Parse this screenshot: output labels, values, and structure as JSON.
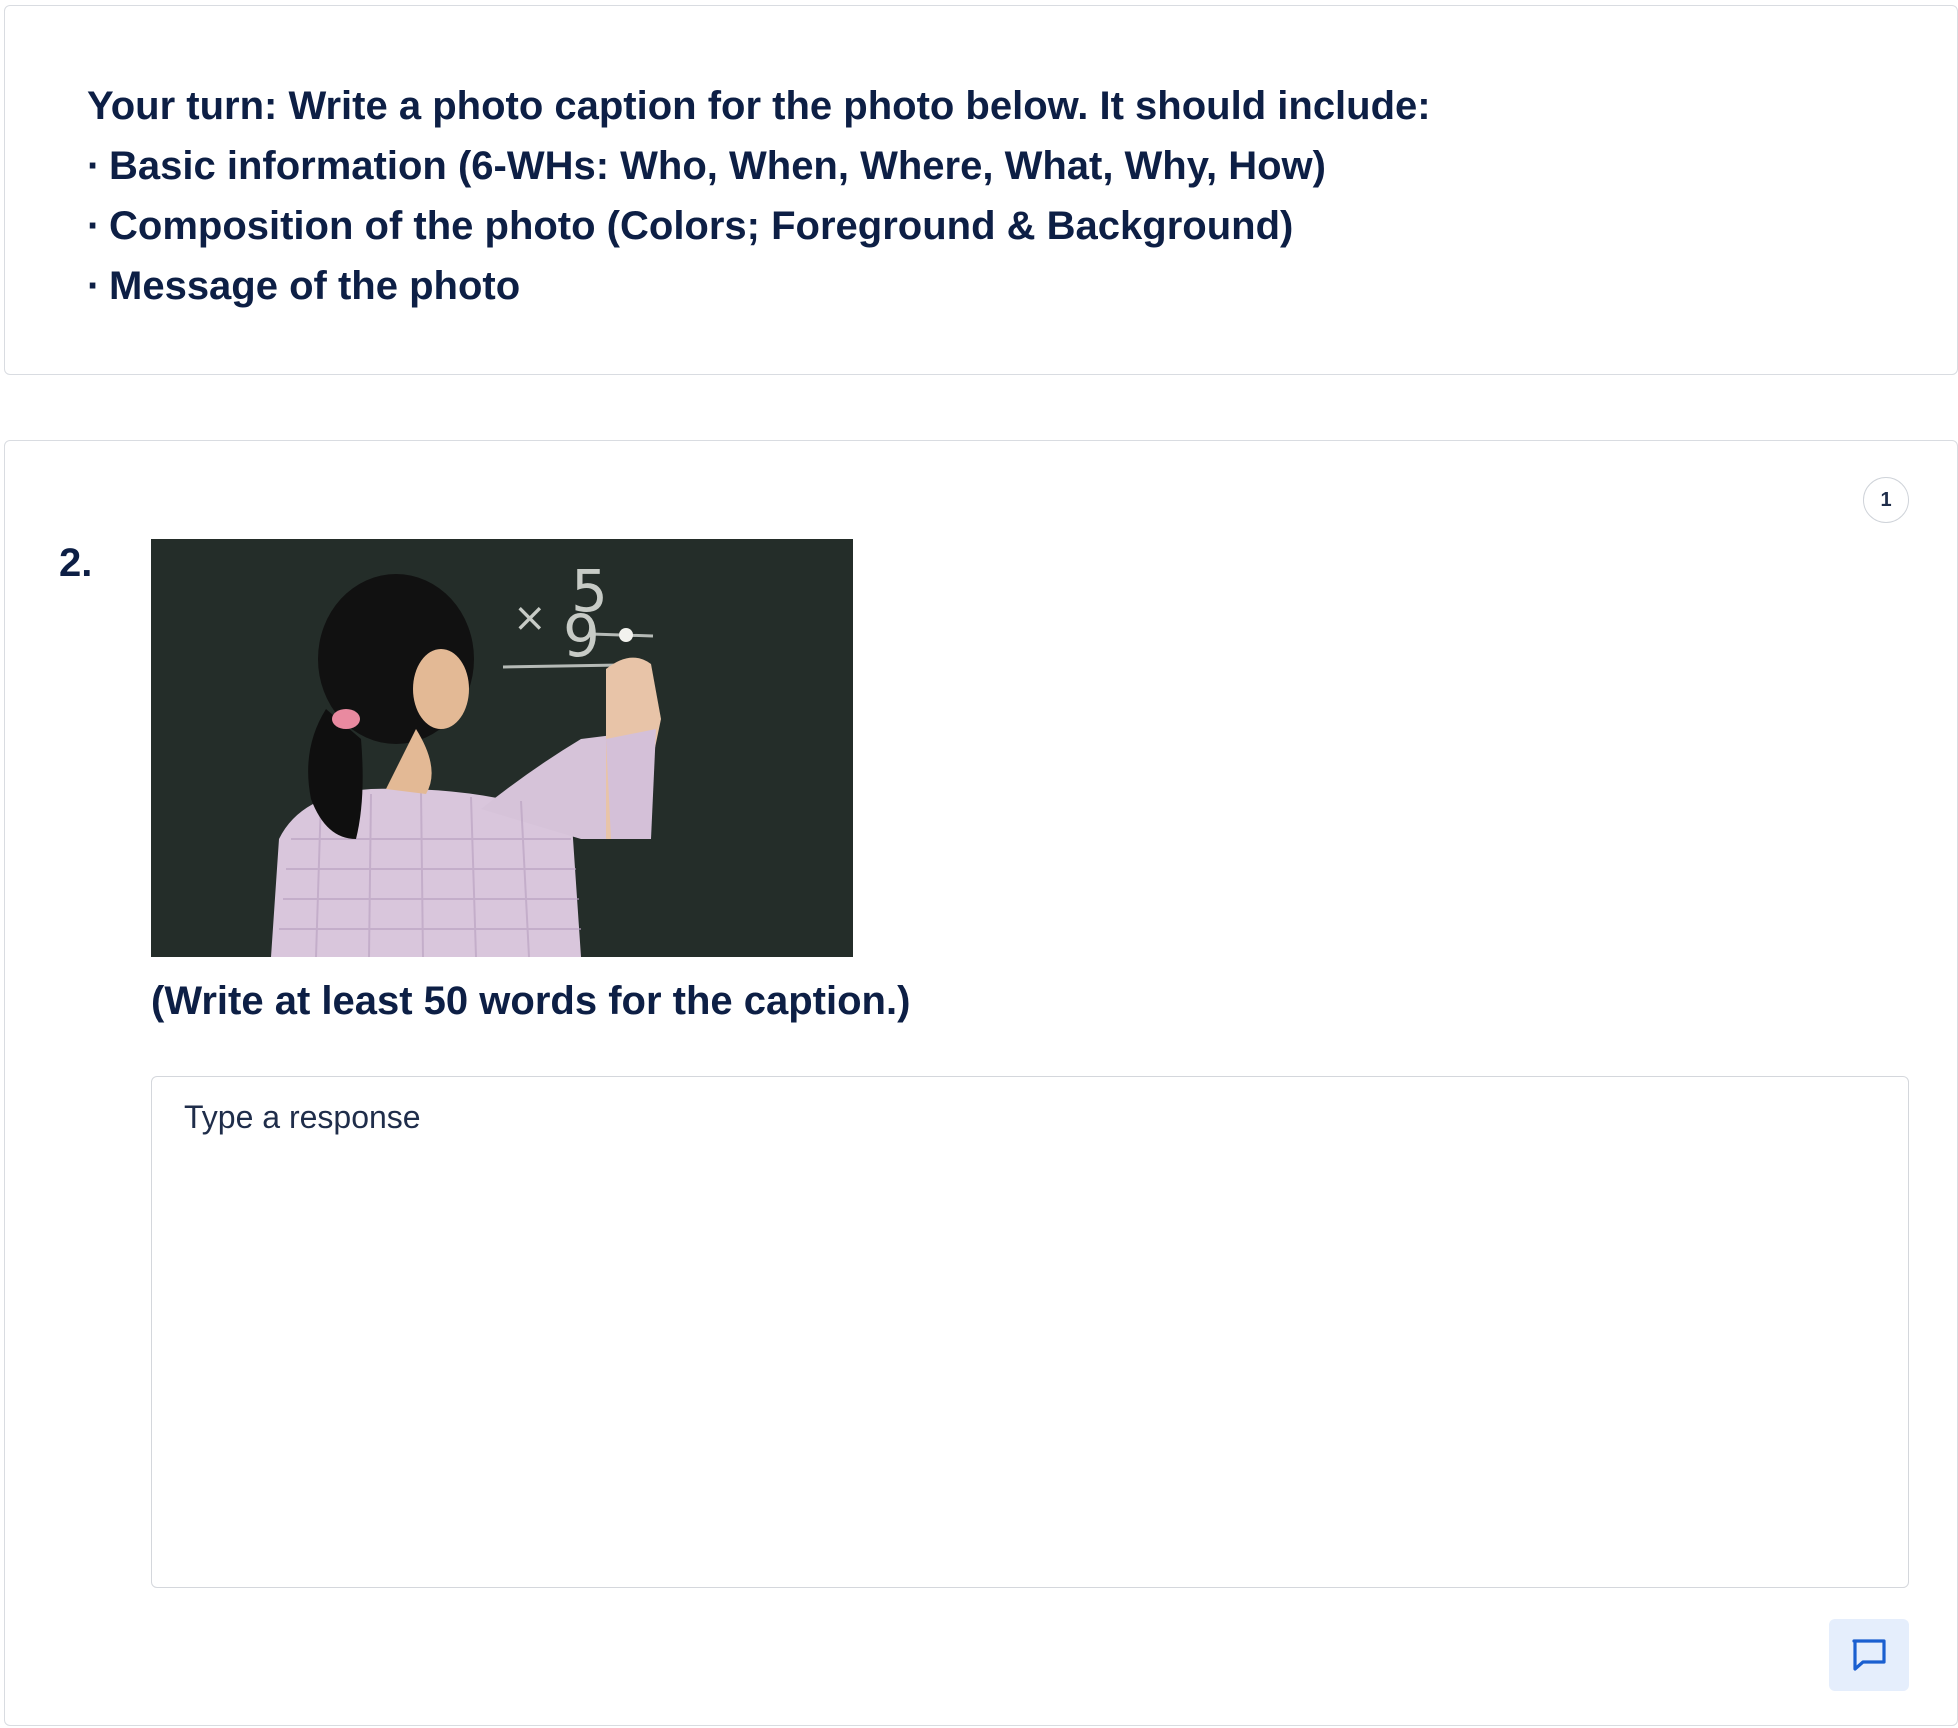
{
  "intro": {
    "lead_bold": "Your turn:",
    "lead_text": " Write a photo caption for the photo below. It should include:",
    "bullets": [
      "Basic information (6-WHs: Who, When, Where, What, Why, How)",
      "Composition of the photo (Colors; Foreground & Background)",
      "Message of the photo"
    ],
    "bullet_symbol": "·"
  },
  "question": {
    "number": "2.",
    "points": "1",
    "photo": {
      "chalk_digits": [
        "5",
        "×",
        "9"
      ]
    },
    "hint": "(Write at least 50 words for the caption.)",
    "response": {
      "placeholder": "Type a response"
    },
    "comment_icon": "comment-icon"
  },
  "colors": {
    "text": "#0d1f45",
    "chalkboard": "#27302c",
    "accent": "#1a5fd0",
    "comment_bg": "#e5eefc"
  }
}
